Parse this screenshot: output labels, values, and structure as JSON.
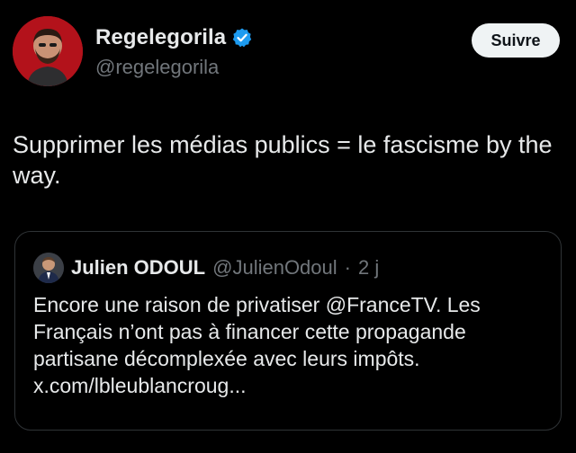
{
  "author": {
    "display_name": "Regelegorila",
    "handle": "@regelegorila",
    "verified_color": "#1d9bf0",
    "avatar_background": "#b3121b"
  },
  "follow_button": {
    "label": "Suivre"
  },
  "tweet": {
    "text": "Supprimer les médias publics = le fascisme by the way."
  },
  "quote": {
    "author_name": "Julien ODOUL",
    "author_handle": "@JulienOdoul",
    "separator": "·",
    "time": "2 j",
    "lines": [
      "Encore une raison de privatiser @FranceTV. Les",
      "Français n’ont pas à financer cette propagande",
      "partisane décomplexée avec leurs impôts.",
      "x.com/lbleublancroug..."
    ]
  },
  "theme": {
    "background": "#000000",
    "text": "#e7e9ea",
    "secondary_text": "#71767b",
    "border": "#2f3336"
  }
}
